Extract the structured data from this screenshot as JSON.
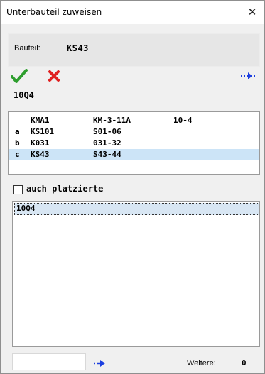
{
  "window": {
    "title": "Unterbauteil zuweisen",
    "close_glyph": "✕"
  },
  "bauteil": {
    "label": "Bauteil:",
    "value": "KS43"
  },
  "toolbar": {
    "ok_icon": "checkmark-icon",
    "cancel_icon": "cross-icon",
    "next_icon": "arrow-right-icon",
    "ok_color": "#2e9e2e",
    "cancel_color": "#e02020",
    "arrow_color": "#1c3fe0"
  },
  "code_label": "10Q4",
  "parts_list": {
    "rows": [
      {
        "letter": "",
        "a": "KMA1",
        "b": "KM-3-11A",
        "c": "10-4"
      },
      {
        "letter": "a",
        "a": "KS101",
        "b": "S01-06",
        "c": ""
      },
      {
        "letter": "b",
        "a": "K031",
        "b": "031-32",
        "c": ""
      },
      {
        "letter": "c",
        "a": "KS43",
        "b": "S43-44",
        "c": ""
      }
    ],
    "selected_index": 3,
    "selected_color": "#cce4f7"
  },
  "options": {
    "auch_platzierte_label": "auch platzierte",
    "auch_platzierte_checked": false
  },
  "listbox": {
    "items": [
      "10Q4"
    ]
  },
  "footer": {
    "input_value": "",
    "weitere_label": "Weitere:",
    "weitere_count": "0"
  }
}
